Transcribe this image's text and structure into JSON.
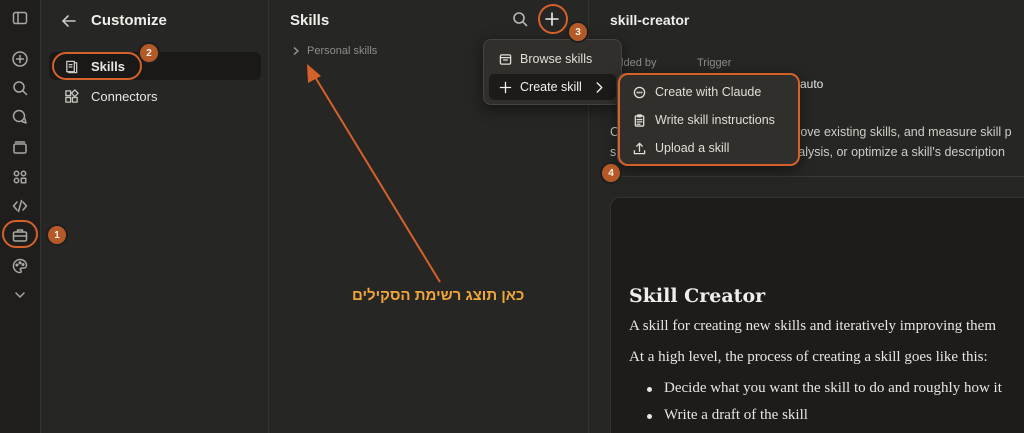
{
  "rail": {
    "icons": [
      "sidebar-toggle-icon",
      "new-chat-icon",
      "search-icon",
      "chats-icon",
      "projects-icon",
      "artifacts-icon",
      "code-icon",
      "customize-icon",
      "palette-icon",
      "more-chevron-icon"
    ]
  },
  "customize": {
    "title": "Customize",
    "items": [
      {
        "label": "Skills",
        "icon": "skills-icon",
        "active": true
      },
      {
        "label": "Connectors",
        "icon": "connectors-icon",
        "active": false
      }
    ]
  },
  "skills_panel": {
    "title": "Skills",
    "personal_skills": "Personal skills"
  },
  "add_menu": {
    "items": [
      {
        "label": "Browse skills",
        "icon": "browse-icon"
      },
      {
        "label": "Create skill",
        "icon": "plus-icon",
        "has_submenu": true
      }
    ]
  },
  "create_submenu": {
    "items": [
      {
        "label": "Create with Claude",
        "icon": "chat-bubble-icon"
      },
      {
        "label": "Write skill instructions",
        "icon": "clipboard-icon"
      },
      {
        "label": "Upload a skill",
        "icon": "upload-icon"
      }
    ]
  },
  "detail": {
    "title": "skill-creator",
    "added_by_label": "Added by",
    "trigger_label": "Trigger",
    "trigger_value": "auto",
    "description_line1": "Create new skills, modify and improve existing skills, and measure skill p",
    "description_line2": "skill performance with variance analysis, or optimize a skill's description",
    "card": {
      "heading": "Skill Creator",
      "intro": "A skill for creating new skills and iteratively improving them",
      "process": "At a high level, the process of creating a skill goes like this:",
      "bullets": [
        "Decide what you want the skill to do and roughly how it",
        "Write a draft of the skill"
      ]
    }
  },
  "annotations": {
    "badges": [
      "1",
      "2",
      "3",
      "4"
    ],
    "caption": "כאן תוצג רשימת הסקילים",
    "color": "#d4612a"
  }
}
